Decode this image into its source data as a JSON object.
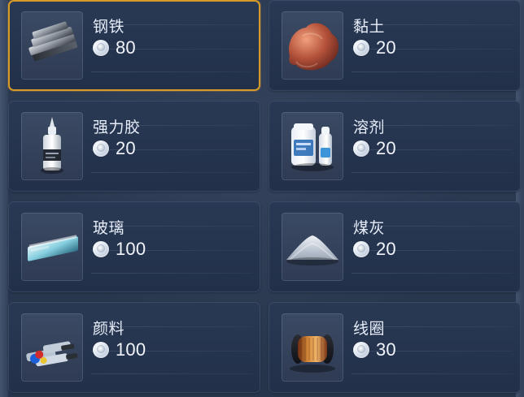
{
  "items": [
    {
      "name": "钢铁",
      "price": "80",
      "icon": "steel-ingot-icon"
    },
    {
      "name": "黏土",
      "price": "20",
      "icon": "clay-icon"
    },
    {
      "name": "强力胶",
      "price": "20",
      "icon": "glue-bottle-icon"
    },
    {
      "name": "溶剂",
      "price": "20",
      "icon": "solvent-bottles-icon"
    },
    {
      "name": "玻璃",
      "price": "100",
      "icon": "glass-sheet-icon"
    },
    {
      "name": "煤灰",
      "price": "20",
      "icon": "ash-pile-icon"
    },
    {
      "name": "颜料",
      "price": "100",
      "icon": "paint-tubes-icon"
    },
    {
      "name": "线圈",
      "price": "30",
      "icon": "copper-coil-icon"
    }
  ],
  "selected_item": "钢铁",
  "colors": {
    "background": "#2b3a52",
    "card": "#263550",
    "selected_border": "#d69a2a",
    "text": "#e6ecf7"
  },
  "currency_icon": "silver-coin-icon"
}
